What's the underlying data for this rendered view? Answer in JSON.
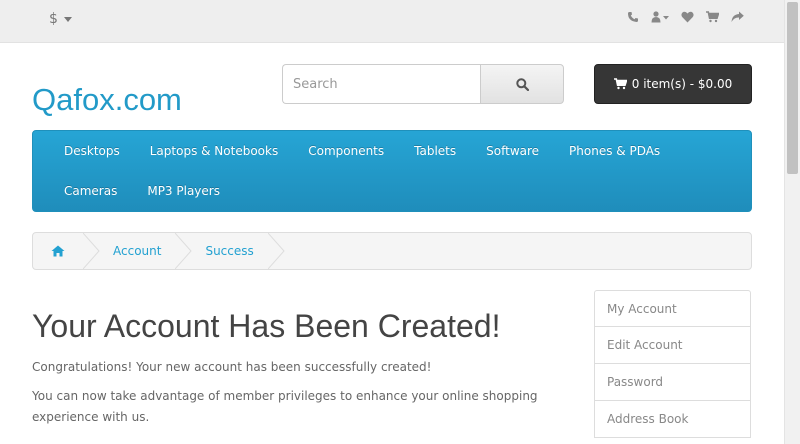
{
  "topbar": {
    "currency_symbol": "$",
    "icons": [
      "phone-icon",
      "user-icon",
      "heart-icon",
      "cart-icon",
      "share-icon"
    ]
  },
  "header": {
    "logo": "Qafox.com",
    "search_placeholder": "Search",
    "cart_label": "0 item(s) - $0.00"
  },
  "menu": {
    "items": [
      "Desktops",
      "Laptops & Notebooks",
      "Components",
      "Tablets",
      "Software",
      "Phones & PDAs",
      "Cameras",
      "MP3 Players"
    ]
  },
  "breadcrumb": {
    "items": [
      "Account",
      "Success"
    ]
  },
  "content": {
    "title": "Your Account Has Been Created!",
    "paragraphs": [
      "Congratulations! Your new account has been successfully created!",
      "You can now take advantage of member privileges to enhance your online shopping experience with us."
    ]
  },
  "sidebar": {
    "items": [
      "My Account",
      "Edit Account",
      "Password",
      "Address Book"
    ]
  },
  "colors": {
    "accent": "#229ac8",
    "menu_bg": "#229ac8",
    "cart_bg": "#363636"
  }
}
